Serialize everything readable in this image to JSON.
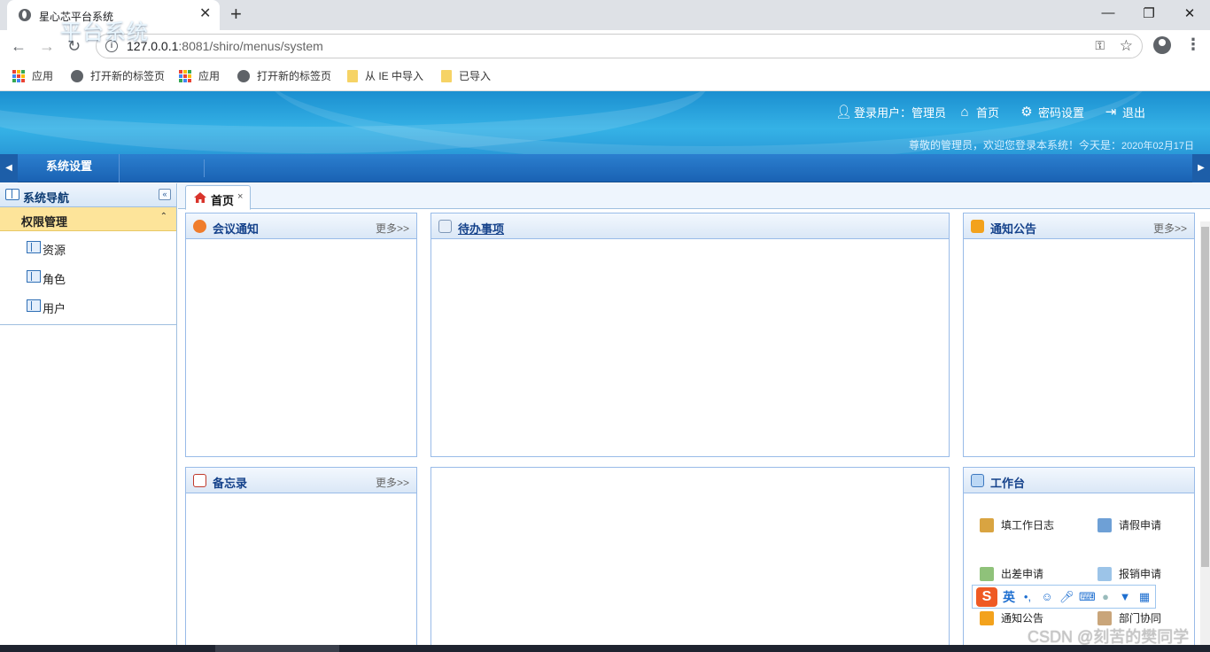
{
  "browser": {
    "tab_title": "星心芯平台系统",
    "tab_close": "✕",
    "new_tab": "+",
    "url_host": "127.0.0.1",
    "url_rest": ":8081/shiro/menus/system",
    "window_controls": {
      "minimize": "—",
      "restore": "❐",
      "close": "✕"
    },
    "nav": {
      "back": "←",
      "forward": "→",
      "reload": "↻"
    }
  },
  "bookmarks": [
    {
      "label": "应用",
      "icon": "apps-grid-icon"
    },
    {
      "label": "打开新的标签页",
      "icon": "globe-icon"
    },
    {
      "label": "应用",
      "icon": "apps-grid-icon"
    },
    {
      "label": "打开新的标签页",
      "icon": "globe-icon"
    },
    {
      "label": "从 IE 中导入",
      "icon": "folder-icon"
    },
    {
      "label": "已导入",
      "icon": "folder-icon"
    }
  ],
  "header": {
    "brand": "平台系统",
    "links": {
      "user": "登录用户：管理员",
      "home": "首页",
      "password": "密码设置",
      "logout": "退出"
    },
    "welcome": "尊敬的管理员，欢迎您登录本系统！今天是：",
    "date": "2020年02月17日"
  },
  "menubar": {
    "items": [
      "系统设置"
    ],
    "left_arrow": "◀",
    "right_arrow": "▶"
  },
  "sidebar": {
    "title": "系统导航",
    "collapse": "«",
    "group": "权限管理",
    "group_toggle": "⌃",
    "items": [
      "资源",
      "角色",
      "用户"
    ]
  },
  "content_tabs": [
    {
      "label": "首页",
      "close": "×"
    }
  ],
  "panels": {
    "meeting": {
      "title": "会议通知",
      "more": "更多>>"
    },
    "todo": {
      "title": "待办事项"
    },
    "notice": {
      "title": "通知公告",
      "more": "更多>>"
    },
    "memo": {
      "title": "备忘录",
      "more": "更多>>"
    },
    "workbench": {
      "title": "工作台",
      "items": [
        "填工作日志",
        "请假申请",
        "出差申请",
        "报销申请",
        "通知公告",
        "部门协同"
      ]
    }
  },
  "ime": {
    "logo": "S",
    "mode": "英"
  },
  "watermark": "CSDN @刻苦的樊同学",
  "colors": {
    "header_blue": "#2a9ad8",
    "menubar_blue": "#1a62b3",
    "group_yellow": "#fde49a",
    "panel_title": "#15428b"
  }
}
